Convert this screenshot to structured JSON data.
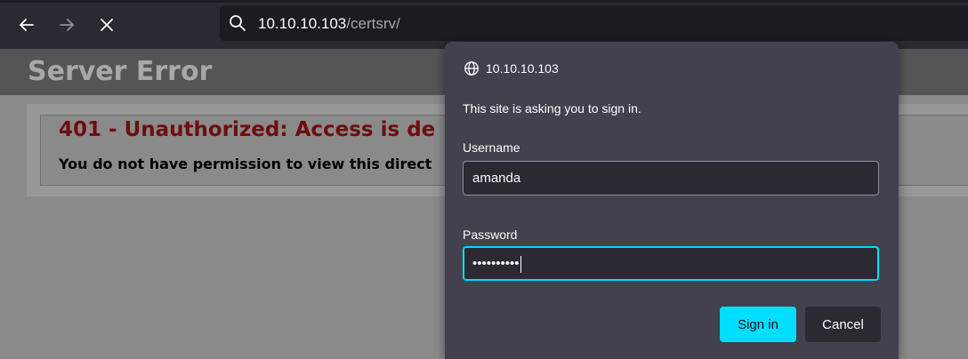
{
  "browser": {
    "url_host": "10.10.10.103",
    "url_path": "/certsrv/"
  },
  "page": {
    "header": "Server Error",
    "error_title": "401 - Unauthorized: Access is de",
    "error_message": "You do not have permission to view this direct"
  },
  "dialog": {
    "origin": "10.10.10.103",
    "prompt": "This site is asking you to sign in.",
    "username_label": "Username",
    "username_value": "amanda",
    "password_label": "Password",
    "password_masked": "••••••••••",
    "signin_label": "Sign in",
    "cancel_label": "Cancel"
  },
  "colors": {
    "accent": "#00ddff",
    "dialog_bg": "#42414d",
    "error_red": "#6f0e0e"
  }
}
